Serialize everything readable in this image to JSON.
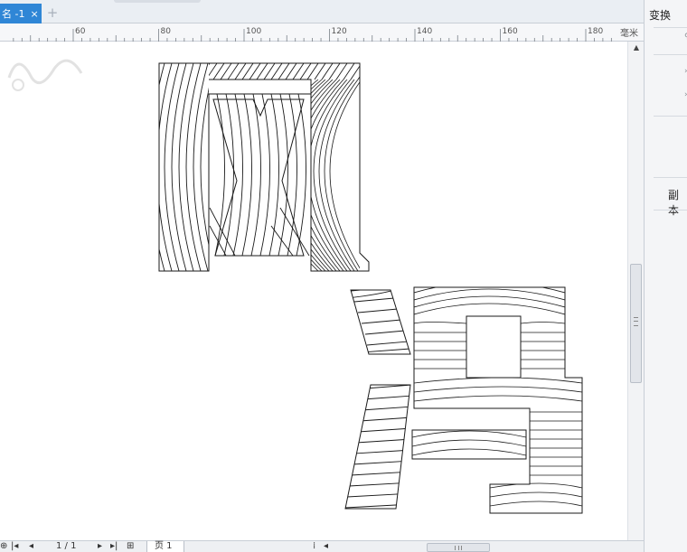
{
  "document_tab": {
    "label": "名 -1",
    "close_glyph": "×",
    "add_glyph": "+"
  },
  "ruler": {
    "unit": "毫米",
    "ticks": [
      "60",
      "80",
      "100",
      "120",
      "140",
      "160",
      "180"
    ]
  },
  "docker": {
    "title": "变换",
    "copies_label": "副本"
  },
  "status": {
    "page_count": "1 / 1",
    "page_tab": "页 1"
  },
  "icons": {
    "first_page": "first-page-icon",
    "prev_page": "prev-page-icon",
    "next_page": "next-page-icon",
    "last_page": "last-page-icon",
    "add_page": "add-page-icon",
    "scroll_up": "scroll-up-icon",
    "scroll_left": "scroll-left-icon"
  },
  "colors": {
    "tab_active": "#2f86d6",
    "artwork_stroke": "#1a1a1a"
  }
}
